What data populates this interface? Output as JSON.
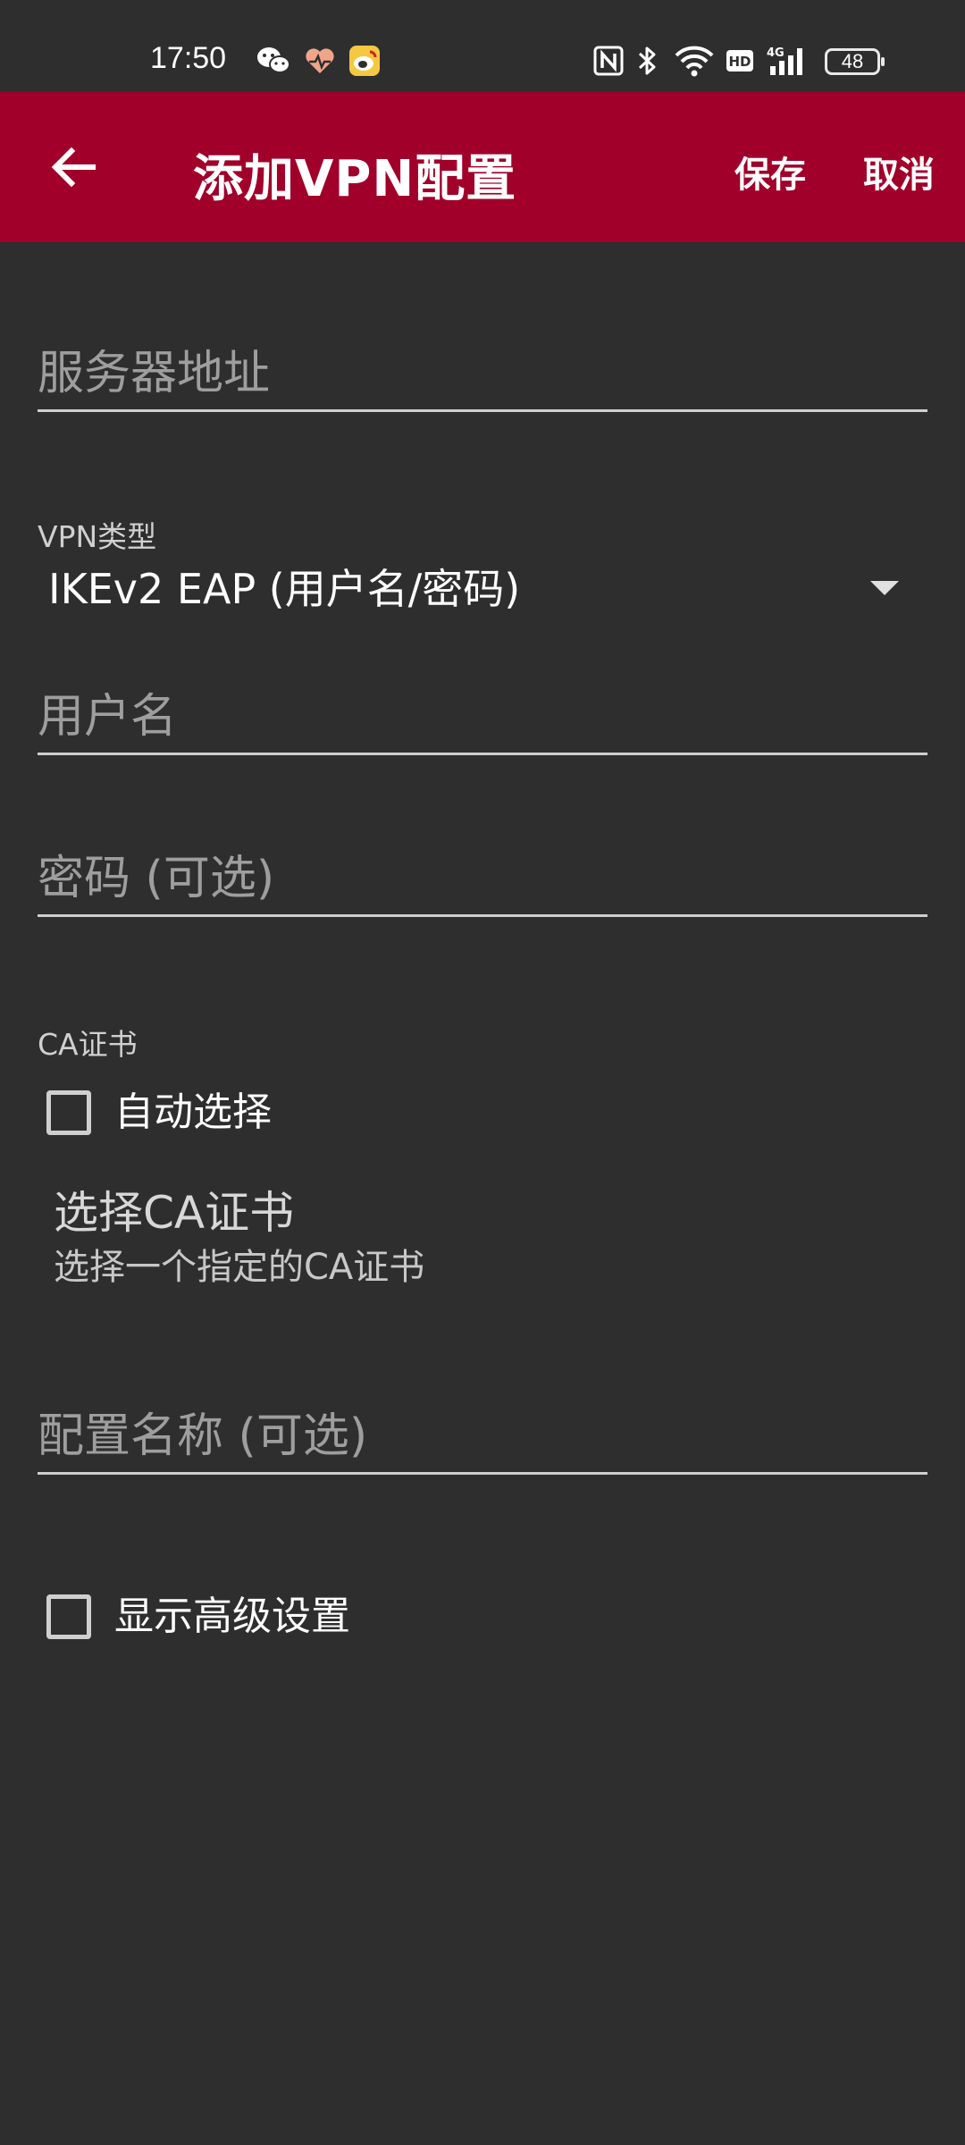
{
  "status_bar": {
    "time": "17:50",
    "battery_level": "48",
    "icons": [
      "wechat-icon",
      "health-icon",
      "weibo-icon",
      "nfc-icon",
      "bluetooth-icon",
      "wifi-icon",
      "hd-icon",
      "signal-4g-icon",
      "battery-icon"
    ]
  },
  "app_bar": {
    "back_icon": "arrow-left-icon",
    "title": "添加VPN配置",
    "save_label": "保存",
    "cancel_label": "取消",
    "background_color": "#a0002a"
  },
  "form": {
    "server_address": {
      "placeholder": "服务器地址",
      "value": ""
    },
    "vpn_type": {
      "label": "VPN类型",
      "selected": "IKEv2 EAP (用户名/密码)"
    },
    "username": {
      "placeholder": "用户名",
      "value": ""
    },
    "password": {
      "placeholder": "密码 (可选)",
      "value": ""
    },
    "ca_certificate": {
      "label": "CA证书",
      "auto_select_label": "自动选择",
      "auto_select_checked": false,
      "select_title": "选择CA证书",
      "select_summary": "选择一个指定的CA证书"
    },
    "profile_name": {
      "placeholder": "配置名称 (可选)",
      "value": ""
    },
    "show_advanced": {
      "label": "显示高级设置",
      "checked": false
    }
  }
}
